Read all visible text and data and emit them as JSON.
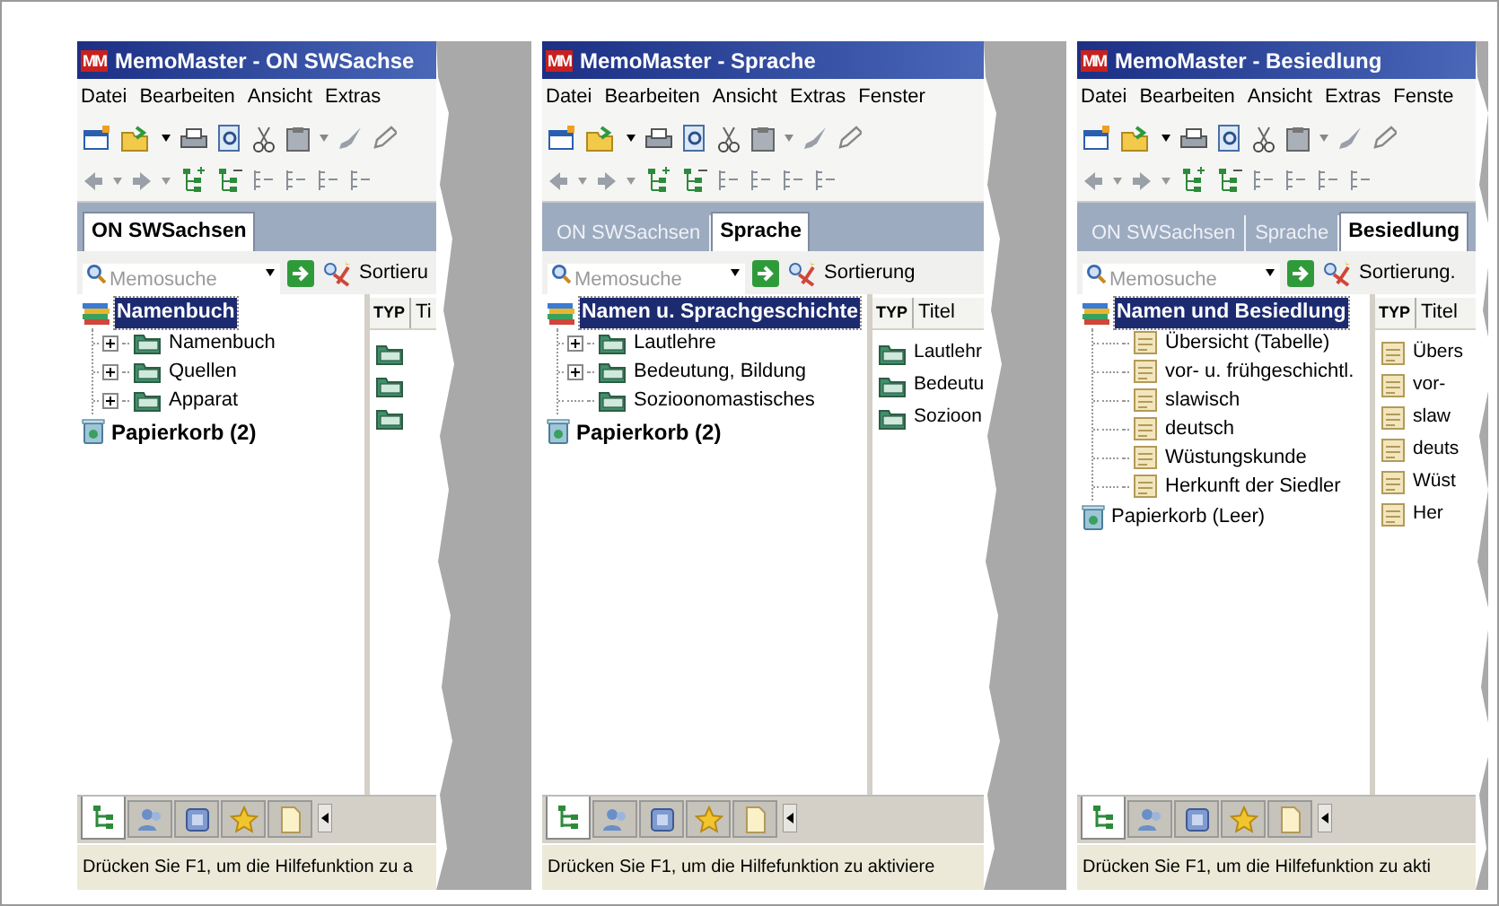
{
  "panels": [
    {
      "logo": "MM",
      "title": "MemoMaster - ON SWSachse",
      "menu": [
        "Datei",
        "Bearbeiten",
        "Ansicht",
        "Extras"
      ],
      "tabs": [
        {
          "label": "ON SWSachsen",
          "selected": true
        }
      ],
      "search": {
        "placeholder": "Memosuche"
      },
      "sort_label": "Sortieru",
      "tree": {
        "label": "Namenbuch",
        "selected": true,
        "children": [
          {
            "label": "Namenbuch",
            "kind": "folder",
            "expandable": true
          },
          {
            "label": "Quellen",
            "kind": "folder",
            "expandable": true
          },
          {
            "label": "Apparat",
            "kind": "folder",
            "expandable": true
          }
        ]
      },
      "trash": {
        "label": "Papierkorb (2)",
        "has_items": true
      },
      "list": {
        "columns": [
          "TYP",
          "Ti"
        ],
        "rows": [
          {
            "kind": "folder"
          },
          {
            "kind": "folder"
          },
          {
            "kind": "folder"
          }
        ]
      },
      "bottom_tabs": [
        {
          "kind": "tree",
          "selected": true
        },
        {
          "kind": "people",
          "selected": false
        },
        {
          "kind": "box",
          "selected": false
        },
        {
          "kind": "star",
          "selected": false
        },
        {
          "kind": "page",
          "selected": false
        }
      ],
      "status": "Drücken Sie F1, um die Hilfefunktion zu a"
    },
    {
      "logo": "MM",
      "title": "MemoMaster - Sprache",
      "menu": [
        "Datei",
        "Bearbeiten",
        "Ansicht",
        "Extras",
        "Fenster"
      ],
      "tabs": [
        {
          "label": "ON SWSachsen",
          "selected": false
        },
        {
          "label": "Sprache",
          "selected": true
        }
      ],
      "search": {
        "placeholder": "Memosuche"
      },
      "sort_label": "Sortierung",
      "tree": {
        "label": "Namen u. Sprachgeschichte",
        "selected": true,
        "children": [
          {
            "label": "Lautlehre",
            "kind": "folder",
            "expandable": true
          },
          {
            "label": "Bedeutung, Bildung",
            "kind": "folder",
            "expandable": true
          },
          {
            "label": "Sozioonomastisches",
            "kind": "folder",
            "expandable": false
          }
        ]
      },
      "trash": {
        "label": "Papierkorb (2)",
        "has_items": true
      },
      "list": {
        "columns": [
          "TYP",
          "Titel"
        ],
        "rows": [
          {
            "kind": "folder",
            "title": "Lautlehr"
          },
          {
            "kind": "folder",
            "title": "Bedeutu"
          },
          {
            "kind": "folder",
            "title": "Sozioon"
          }
        ]
      },
      "bottom_tabs": [
        {
          "kind": "tree",
          "selected": true
        },
        {
          "kind": "people",
          "selected": false
        },
        {
          "kind": "box",
          "selected": false
        },
        {
          "kind": "star",
          "selected": false
        },
        {
          "kind": "page",
          "selected": false
        }
      ],
      "status": "Drücken Sie F1, um die Hilfefunktion zu aktiviere"
    },
    {
      "logo": "MM",
      "title": "MemoMaster - Besiedlung",
      "menu": [
        "Datei",
        "Bearbeiten",
        "Ansicht",
        "Extras",
        "Fenste"
      ],
      "tabs": [
        {
          "label": "ON SWSachsen",
          "selected": false
        },
        {
          "label": "Sprache",
          "selected": false
        },
        {
          "label": "Besiedlung",
          "selected": true
        }
      ],
      "search": {
        "placeholder": "Memosuche"
      },
      "sort_label": "Sortierung.",
      "tree": {
        "label": "Namen und Besiedlung",
        "selected": true,
        "children": [
          {
            "label": "Übersicht (Tabelle)",
            "kind": "note",
            "expandable": false
          },
          {
            "label": "vor- u. frühgeschichtl.",
            "kind": "note",
            "expandable": false
          },
          {
            "label": "slawisch",
            "kind": "note",
            "expandable": false
          },
          {
            "label": "deutsch",
            "kind": "note",
            "expandable": false
          },
          {
            "label": "Wüstungskunde",
            "kind": "note",
            "expandable": false
          },
          {
            "label": "Herkunft der Siedler",
            "kind": "note",
            "expandable": false
          }
        ]
      },
      "trash": {
        "label": "Papierkorb (Leer)",
        "has_items": false
      },
      "list": {
        "columns": [
          "TYP",
          "Titel"
        ],
        "rows": [
          {
            "kind": "note",
            "title": "Übers"
          },
          {
            "kind": "note",
            "title": "vor-"
          },
          {
            "kind": "note",
            "title": "slaw"
          },
          {
            "kind": "note",
            "title": "deuts"
          },
          {
            "kind": "note",
            "title": "Wüst"
          },
          {
            "kind": "note",
            "title": "Her"
          }
        ]
      },
      "bottom_tabs": [
        {
          "kind": "tree",
          "selected": true
        },
        {
          "kind": "people",
          "selected": false
        },
        {
          "kind": "box",
          "selected": false
        },
        {
          "kind": "star",
          "selected": false
        },
        {
          "kind": "page",
          "selected": false
        }
      ],
      "status": "Drücken Sie F1, um die Hilfefunktion zu akti"
    }
  ]
}
